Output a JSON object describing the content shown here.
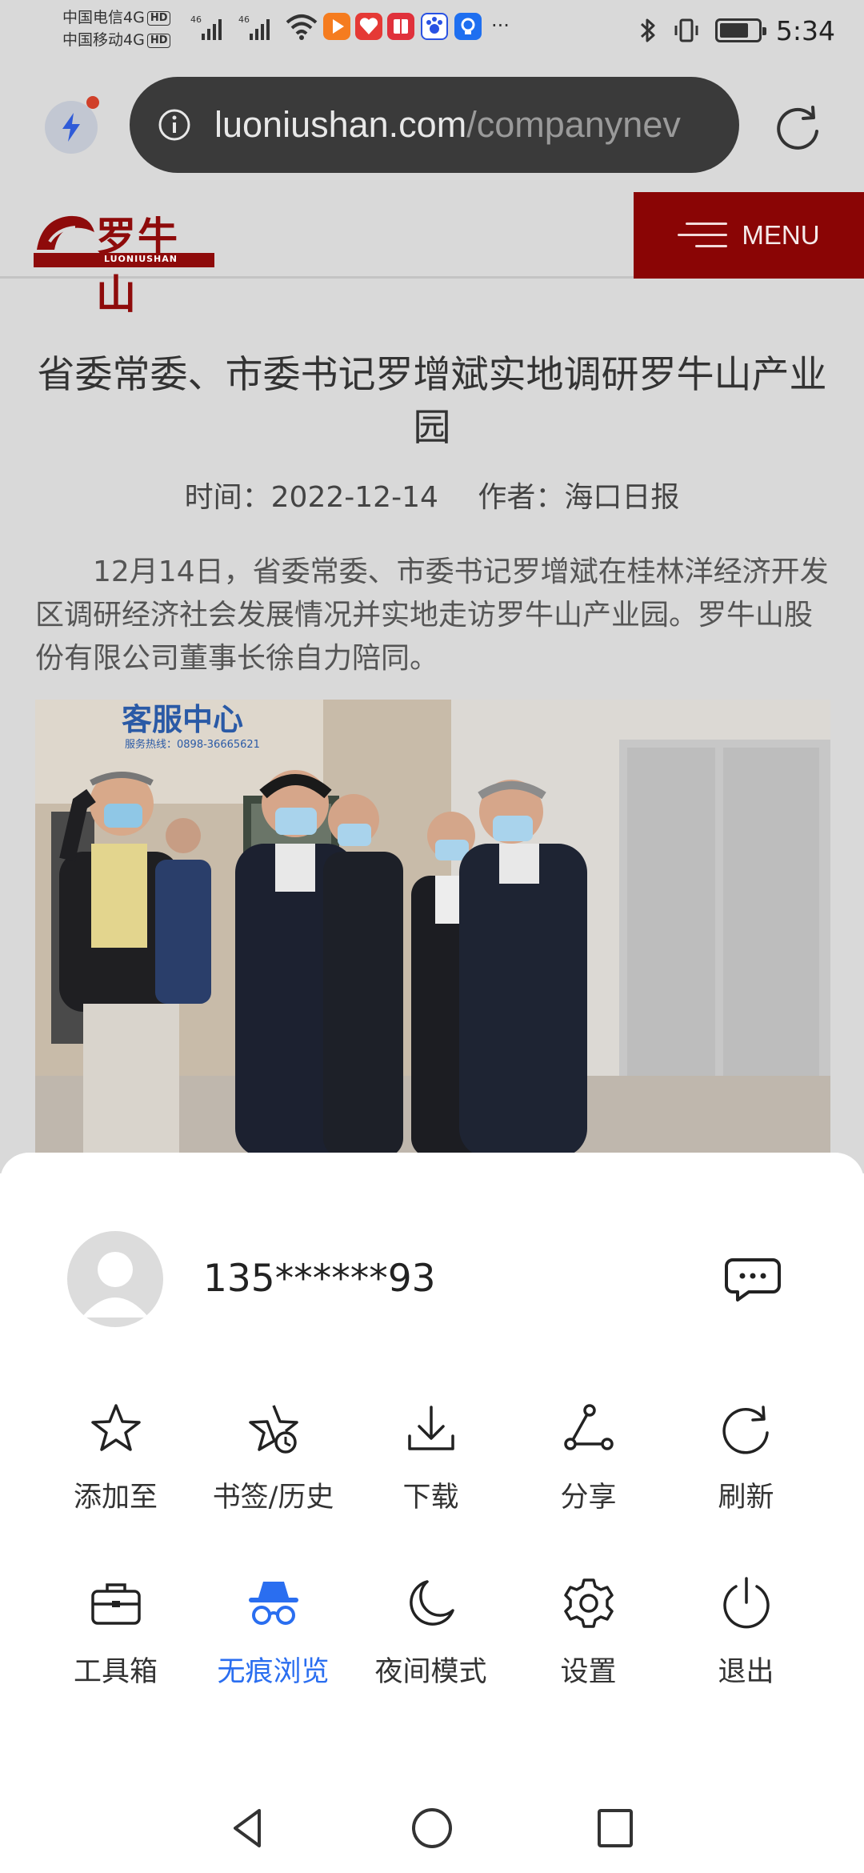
{
  "status_bar": {
    "carrier_1": "中国电信4G",
    "carrier_2": "中国移动4G",
    "hd_badge": "HD",
    "network_1": "46",
    "network_2": "46",
    "more": "···",
    "time": "5:34",
    "battery_level": 0.75
  },
  "browser": {
    "url_domain": "luoniushan.com",
    "url_path": "/companynev"
  },
  "site": {
    "logo_text": "罗牛山",
    "logo_subtext": "LUONIUSHAN",
    "menu_label": "MENU",
    "brand_color": "#8a0505"
  },
  "article": {
    "title": "省委常委、市委书记罗增斌实地调研罗牛山产业园",
    "time_label": "时间：2022-12-14",
    "author_label": "作者：海口日报",
    "body": "12月14日，省委常委、市委书记罗增斌在桂林洋经济开发区调研经济社会发展情况并实地走访罗牛山产业园。罗牛山股份有限公司董事长徐自力陪同。",
    "photo_sign_text": "客服中心",
    "photo_sign_phone": "服务热线：0898-36665621"
  },
  "sheet": {
    "account": "135******93",
    "accent_color": "#2a6ef0",
    "row1": [
      {
        "label": "添加至",
        "icon": "star-icon"
      },
      {
        "label": "书签/历史",
        "icon": "bookmark-history-icon"
      },
      {
        "label": "下载",
        "icon": "download-icon"
      },
      {
        "label": "分享",
        "icon": "share-icon"
      },
      {
        "label": "刷新",
        "icon": "refresh-icon"
      }
    ],
    "row2": [
      {
        "label": "工具箱",
        "icon": "toolbox-icon"
      },
      {
        "label": "无痕浏览",
        "icon": "incognito-icon",
        "active": true
      },
      {
        "label": "夜间模式",
        "icon": "moon-icon"
      },
      {
        "label": "设置",
        "icon": "gear-icon"
      },
      {
        "label": "退出",
        "icon": "power-icon"
      }
    ]
  }
}
